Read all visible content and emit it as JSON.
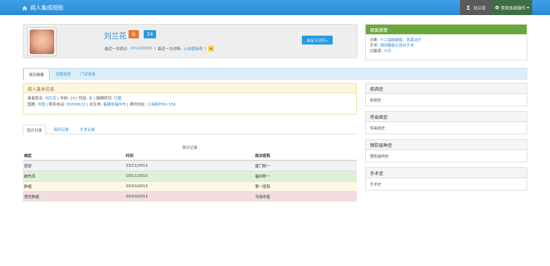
{
  "nav": {
    "title": "病人集成视图",
    "user": "刘兰花",
    "system_menu": "常用系统操作"
  },
  "patient": {
    "name": "刘兰花",
    "sex": "女",
    "age": "24",
    "last_visit_label": "最近一次就诊:",
    "last_visit": "2012/03/03",
    "last_diag_label": "最近一次诊断:",
    "last_diag": "心血管疾病",
    "custom_button": "自定义诊疗»"
  },
  "summary": {
    "title": "病案摘要",
    "diag_label": "诊断:",
    "diag": "十二指肠破裂、急需治疗",
    "surgery_label": "手术:",
    "surgery": "视网膜裂孔修补手术",
    "allergy_label": "过敏源:",
    "allergy": "川贝"
  },
  "tabs": [
    "病历概要",
    "住院信息",
    "门诊信息"
  ],
  "basic": {
    "title": "病人基本信息",
    "row1": [
      {
        "label": "患者姓名:",
        "value": "刘兰花"
      },
      {
        "label": "年龄:",
        "value": "24"
      },
      {
        "label": "性别:",
        "value": "女"
      },
      {
        "label": "婚姻状况:",
        "value": "已婚"
      }
    ],
    "row2": [
      {
        "label": "国籍:",
        "value": "中国"
      },
      {
        "label": "联系电话:",
        "value": "83836632"
      },
      {
        "label": "出生地:",
        "value": "福建省福州市"
      },
      {
        "label": "通讯地址:",
        "value": "上海新村60-156"
      }
    ]
  },
  "subtabs": [
    "就诊记录",
    "用药记录",
    "手术记录"
  ],
  "visits": {
    "caption": "就诊记录",
    "headers": [
      "病症",
      "时间",
      "就诊医院"
    ],
    "rows": [
      [
        "感冒",
        "23/11/2013",
        "厦门附一"
      ],
      [
        "破伤风",
        "10/11/2013",
        "福州附一"
      ],
      [
        "肿瘤",
        "20/10/2013",
        "第一医院"
      ],
      [
        "恶性肿瘤",
        "20/10/2013",
        "乌海市医"
      ]
    ]
  },
  "history": [
    {
      "title": "疾病史",
      "body": "疾病史"
    },
    {
      "title": "传染病史",
      "body": "传染病史"
    },
    {
      "title": "预防接种史",
      "body": "预防接种史"
    },
    {
      "title": "手术史",
      "body": "手术史"
    }
  ]
}
